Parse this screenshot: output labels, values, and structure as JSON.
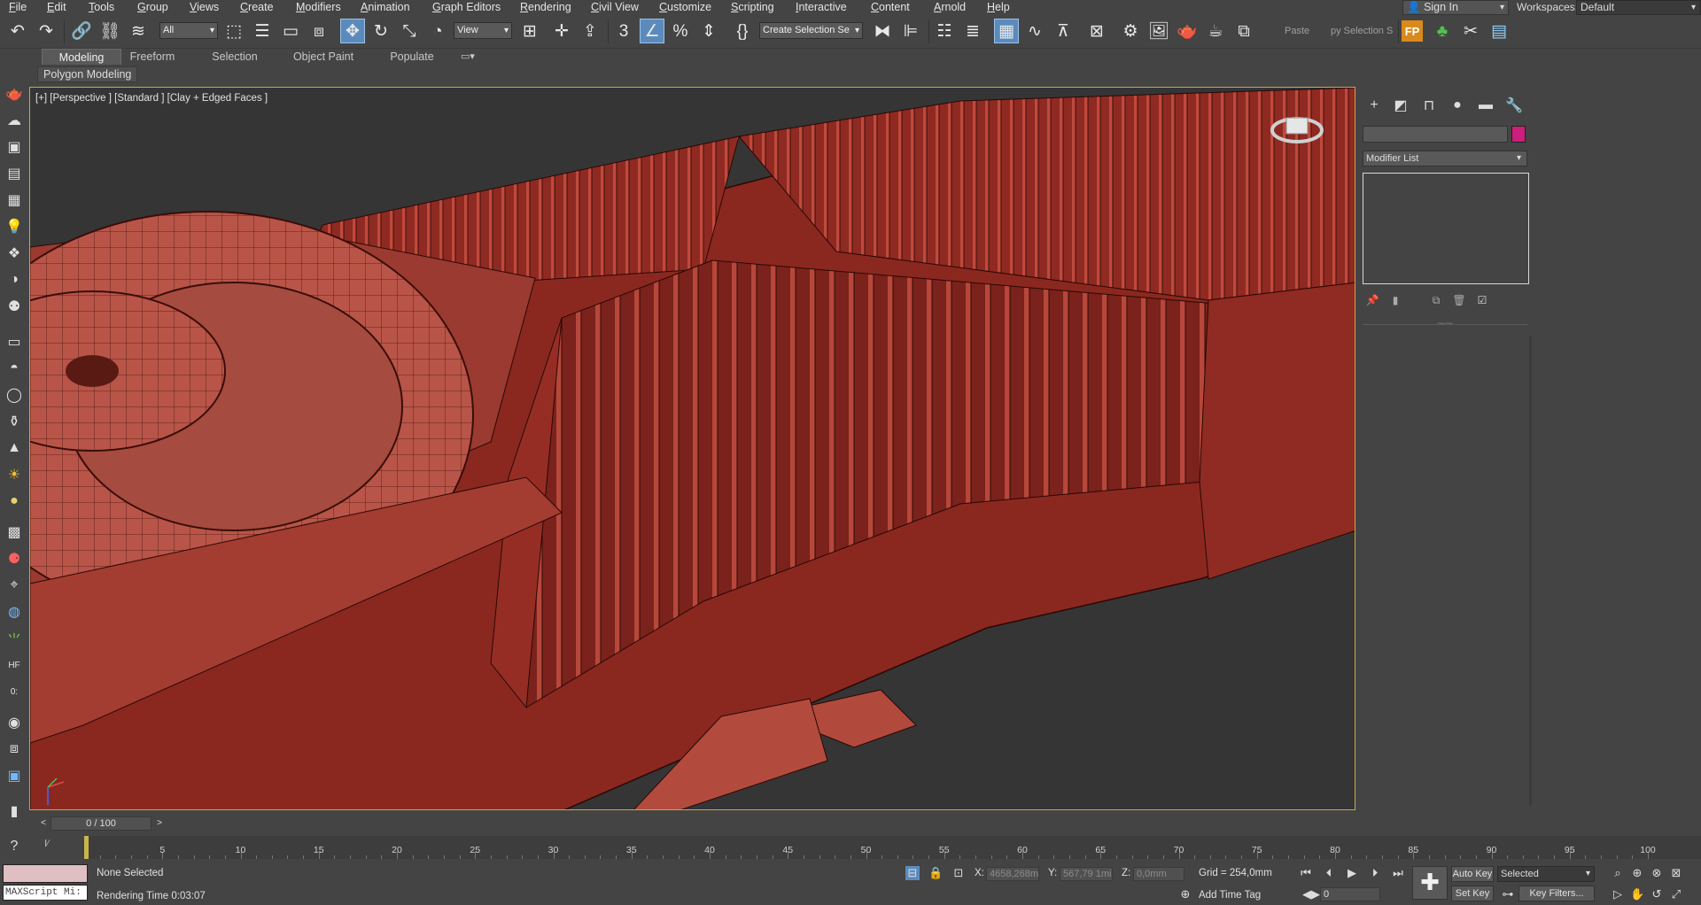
{
  "menu": {
    "items": [
      "File",
      "Edit",
      "Tools",
      "Group",
      "Views",
      "Create",
      "Modifiers",
      "Animation",
      "Graph Editors",
      "Rendering",
      "Civil View",
      "Customize",
      "Scripting",
      "Interactive",
      "Content",
      "Arnold",
      "Help"
    ],
    "sign_in": "Sign In",
    "workspaces_label": "Workspaces:",
    "workspace_value": "Default"
  },
  "toolbar": {
    "filter_value": "All",
    "coord_value": "View",
    "named_selection": "Create Selection Se",
    "paste_label": "Paste",
    "copy_selection_label": "py Selection S"
  },
  "ribbon": {
    "tabs": [
      "Modeling",
      "Freeform",
      "Selection",
      "Object Paint",
      "Populate"
    ],
    "active_tab": "Modeling",
    "panel_label": "Polygon Modeling"
  },
  "viewport": {
    "label": "[+] [Perspective ] [Standard ] [Clay + Edged Faces ]"
  },
  "command_panel": {
    "modifier_list": "Modifier List",
    "object_color": "#cc1e7a"
  },
  "timeline": {
    "frame_counter": "0 / 100",
    "ticks": [
      5,
      10,
      15,
      20,
      25,
      30,
      35,
      40,
      45,
      50,
      55,
      60,
      65,
      70,
      75,
      80,
      85,
      90,
      95,
      100
    ],
    "max_frame": 100
  },
  "status": {
    "maxscript_placeholder": "MAXScript Mi:",
    "selection_text": "None Selected",
    "rendering_time": "Rendering Time  0:03:07",
    "x_label": "X:",
    "x_value": "4658,268m",
    "y_label": "Y:",
    "y_value": "567,79 1mi",
    "z_label": "Z:",
    "z_value": "0,0mm",
    "grid": "Grid = 254,0mm",
    "add_time_tag": "Add Time Tag",
    "auto_key": "Auto Key",
    "set_key": "Set Key",
    "key_mode": "Selected",
    "key_filters": "Key Filters...",
    "frame_value": "0"
  }
}
